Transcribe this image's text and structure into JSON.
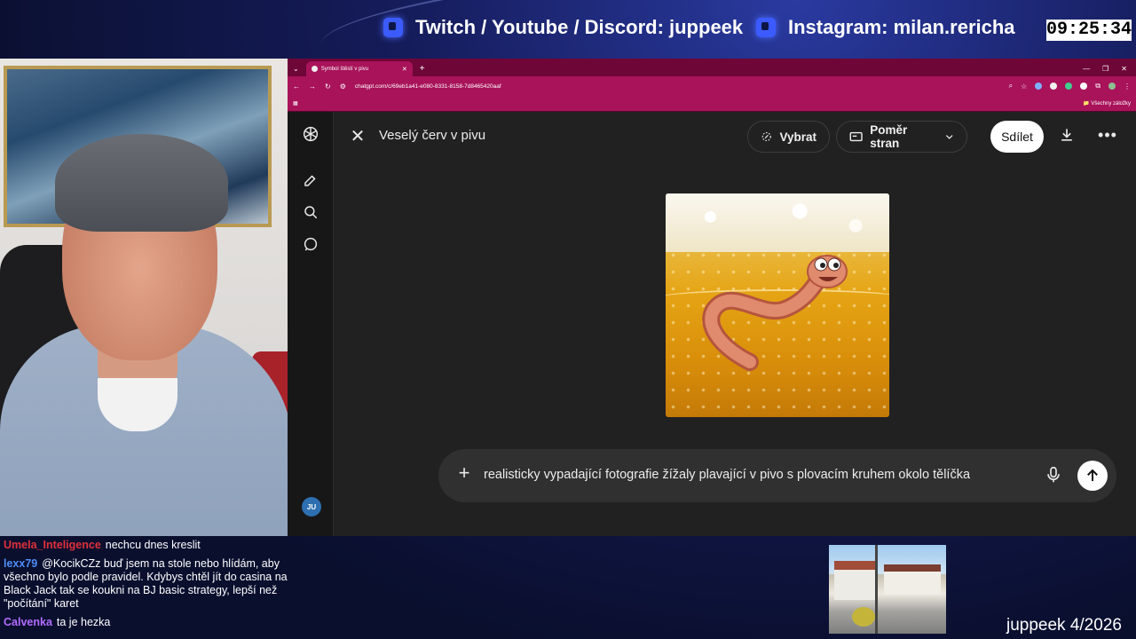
{
  "banner": {
    "social_primary": "Twitch / Youtube / Discord: juppeek",
    "social_instagram": "Instagram: milan.rericha",
    "clock": "09:25:34"
  },
  "browser": {
    "tab_title": "Symbol štěstí v pivu",
    "url": "chatgpt.com/c/69eb1a41-e080-8331-8158-7d8465420aaf",
    "bookmarks_all": "Všechny záložky"
  },
  "viewer": {
    "title": "Veselý červ v pivu",
    "select_label": "Vybrat",
    "aspect_label": "Poměr stran",
    "share_label": "Sdílet"
  },
  "composer": {
    "prompt": "realisticky vypadající fotografie žížaly plavající v pivo s plovacím kruhem okolo tělíčka"
  },
  "sidebar": {
    "avatar_initials": "JU"
  },
  "chat": [
    {
      "user": "Umela_Inteligence",
      "color": "#e0303a",
      "text": "nechcu dnes kreslit"
    },
    {
      "user": "lexx79",
      "color": "#4f8ef7",
      "text": "@KocikCZz buď jsem na stole nebo hlídám, aby všechno bylo podle pravidel. Kdybys chtěl jít do casina na Black Jack tak se koukni na BJ basic strategy, lepší než \"počítání\" karet"
    },
    {
      "user": "Calvenka",
      "color": "#b36cff",
      "text": "ta je hezka"
    }
  ],
  "footer": {
    "channel_date": "juppeek 4/2026"
  },
  "colors": {
    "browser_accent": "#a8135a",
    "app_background": "#212121",
    "overlay_background": "#0a0f2e"
  }
}
